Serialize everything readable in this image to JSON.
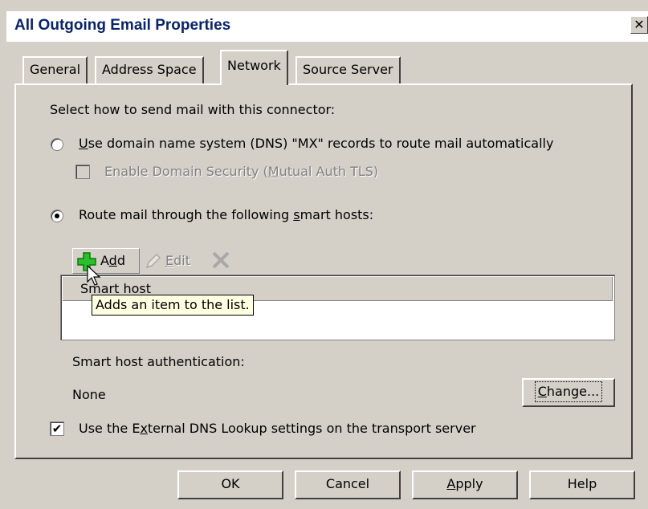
{
  "window": {
    "title": "All Outgoing Email Properties",
    "close_glyph": "✕"
  },
  "tabs": [
    {
      "label": "General",
      "active": false
    },
    {
      "label": "Address Space",
      "active": false
    },
    {
      "label": "Network",
      "active": true
    },
    {
      "label": "Source Server",
      "active": false
    }
  ],
  "network": {
    "intro": "Select how to send mail with this connector:",
    "option_dns": {
      "mnemonic": "U",
      "rest": "se domain name system (DNS) \"MX\" records to route mail automatically",
      "selected": false
    },
    "domain_security": {
      "before": "Enable Domain Security (",
      "mnemonic": "M",
      "after": "utual Auth TLS)",
      "checked": false,
      "enabled": false
    },
    "option_smarthost": {
      "before": "Route mail through the following ",
      "mnemonic": "s",
      "after": "mart hosts:",
      "selected": true
    },
    "toolbar": {
      "add": {
        "before": "A",
        "mnemonic": "d",
        "after": "d",
        "icon": "add-plus-icon",
        "color": "#2bc02b"
      },
      "edit": {
        "mnemonic": "E",
        "after": "dit",
        "icon": "pencil-icon"
      },
      "remove": {
        "icon": "remove-x-icon"
      }
    },
    "list": {
      "column_header": "Smart host",
      "rows": []
    },
    "tooltip": "Adds an item to the list.",
    "auth_label": "Smart host authentication:",
    "auth_value": "None",
    "change_button": {
      "mnemonic": "C",
      "after": "hange..."
    },
    "external_dns": {
      "before": "Use the E",
      "mnemonic": "x",
      "after": "ternal DNS Lookup settings on the transport server",
      "checked": true
    }
  },
  "buttons": {
    "ok": "OK",
    "cancel": "Cancel",
    "apply": {
      "mnemonic": "A",
      "after": "pply"
    },
    "help": "Help"
  }
}
